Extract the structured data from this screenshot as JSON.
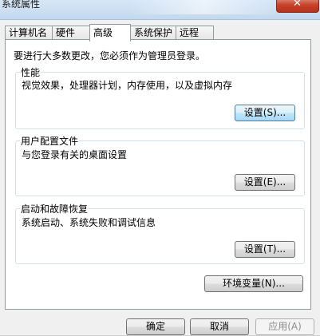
{
  "window": {
    "title": "系统属性"
  },
  "tabs": [
    {
      "label": "计算机名",
      "active": false
    },
    {
      "label": "硬件",
      "active": false
    },
    {
      "label": "高级",
      "active": true
    },
    {
      "label": "系统保护",
      "active": false
    },
    {
      "label": "远程",
      "active": false
    }
  ],
  "panel": {
    "admin_note": "要进行大多数更改，您必须作为管理员登录。",
    "performance": {
      "title": "性能",
      "description": "视觉效果，处理器计划，内存使用，以及虚拟内存",
      "button": "设置(S)..."
    },
    "user_profiles": {
      "title": "用户配置文件",
      "description": "与您登录有关的桌面设置",
      "button": "设置(E)..."
    },
    "startup_recovery": {
      "title": "启动和故障恢复",
      "description": "系统启动、系统失败和调试信息",
      "button": "设置(T)..."
    },
    "env_button": "环境变量(N)..."
  },
  "footer": {
    "ok": "确定",
    "cancel": "取消",
    "apply": "应用(A)"
  },
  "icons": {
    "close": "close-icon"
  }
}
